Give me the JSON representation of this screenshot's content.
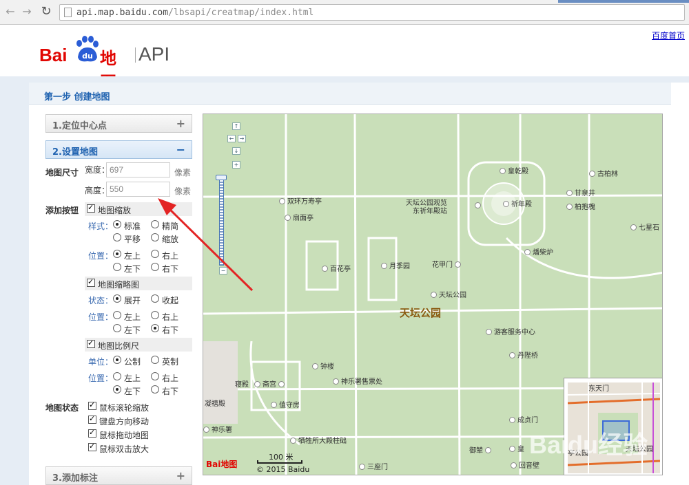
{
  "browser": {
    "url_host": "api.map.baidu.com",
    "url_path": "/lbsapi/creatmap/index.html"
  },
  "header": {
    "logo_bai": "Bai",
    "logo_du": "du",
    "logo_ditu": "地图",
    "logo_api": "API",
    "home_link": "百度首页"
  },
  "step_title": "第一步 创建地图",
  "sections": {
    "locate": {
      "label": "1.定位中心点",
      "sign": "+"
    },
    "setup": {
      "label": "2.设置地图",
      "sign": "−"
    },
    "marker": {
      "label": "3.添加标注",
      "sign": "+"
    }
  },
  "size": {
    "label": "地图尺寸",
    "width_label": "宽度：",
    "width_value": "697",
    "height_label": "高度：",
    "height_value": "550",
    "unit": "像素"
  },
  "buttons": {
    "label": "添加按钮",
    "zoom": {
      "title": "地图缩放",
      "style_label": "样式：",
      "styles": [
        "标准",
        "精简",
        "平移",
        "缩放"
      ],
      "pos_label": "位置：",
      "positions": [
        "左上",
        "右上",
        "左下",
        "右下"
      ]
    },
    "overview": {
      "title": "地图缩略图",
      "state_label": "状态：",
      "states": [
        "展开",
        "收起"
      ],
      "pos_label": "位置：",
      "positions": [
        "左上",
        "右上",
        "左下",
        "右下"
      ]
    },
    "scale": {
      "title": "地图比例尺",
      "unit_label": "单位：",
      "units": [
        "公制",
        "英制"
      ],
      "pos_label": "位置：",
      "positions": [
        "左上",
        "右上",
        "左下",
        "右下"
      ]
    }
  },
  "map_state": {
    "label": "地图状态",
    "options": [
      "鼠标滚轮缩放",
      "键盘方向移动",
      "鼠标拖动地图",
      "鼠标双击放大"
    ]
  },
  "map": {
    "main_label": "天坛公园",
    "labels": {
      "huangqiandian": "皇乾殿",
      "gubolin": "古柏林",
      "shuanghuan": "双环万寿亭",
      "tiantan_guanjing": "天坛公园观览",
      "dongqinian": "东祈年殿站",
      "qiniandian": "祈年殿",
      "ganquanjing": "甘泉井",
      "baihuai": "柏抱槐",
      "qixingshi": "七星石",
      "shanmianting": "扇面亭",
      "baihuating": "百花亭",
      "yuejiyuan": "月季园",
      "huajiamen": "花甲门",
      "zaixiaolu": "燔柴炉",
      "tiantan_small": "天坛公园",
      "youke": "游客服务中心",
      "danbiqiao": "丹陛桥",
      "zhonglou": "钟楼",
      "qingong": "斋宫",
      "shenyueshu_shop": "神乐署售票处",
      "zhidian": "寝殿",
      "ningxidian": "凝禧殿",
      "zhishoufang": "值守房",
      "shenyueshu": "神乐署",
      "xishengsuo": "牺牲所大殿柱础",
      "chengzhenmen": "成贞门",
      "yupan": "御辇",
      "sanzuomen": "三座门",
      "huangqiongyu": "皇",
      "huiyinbi": "回音壁",
      "dongtianmen": "东天门",
      "tingongyuan": "亭公园",
      "ov_tiantan": "天坛公园"
    },
    "scale_text": "100 米",
    "copyright": "© 2015 Baidu",
    "logo_text": "Bai地图"
  },
  "watermark": "Baidu经验"
}
